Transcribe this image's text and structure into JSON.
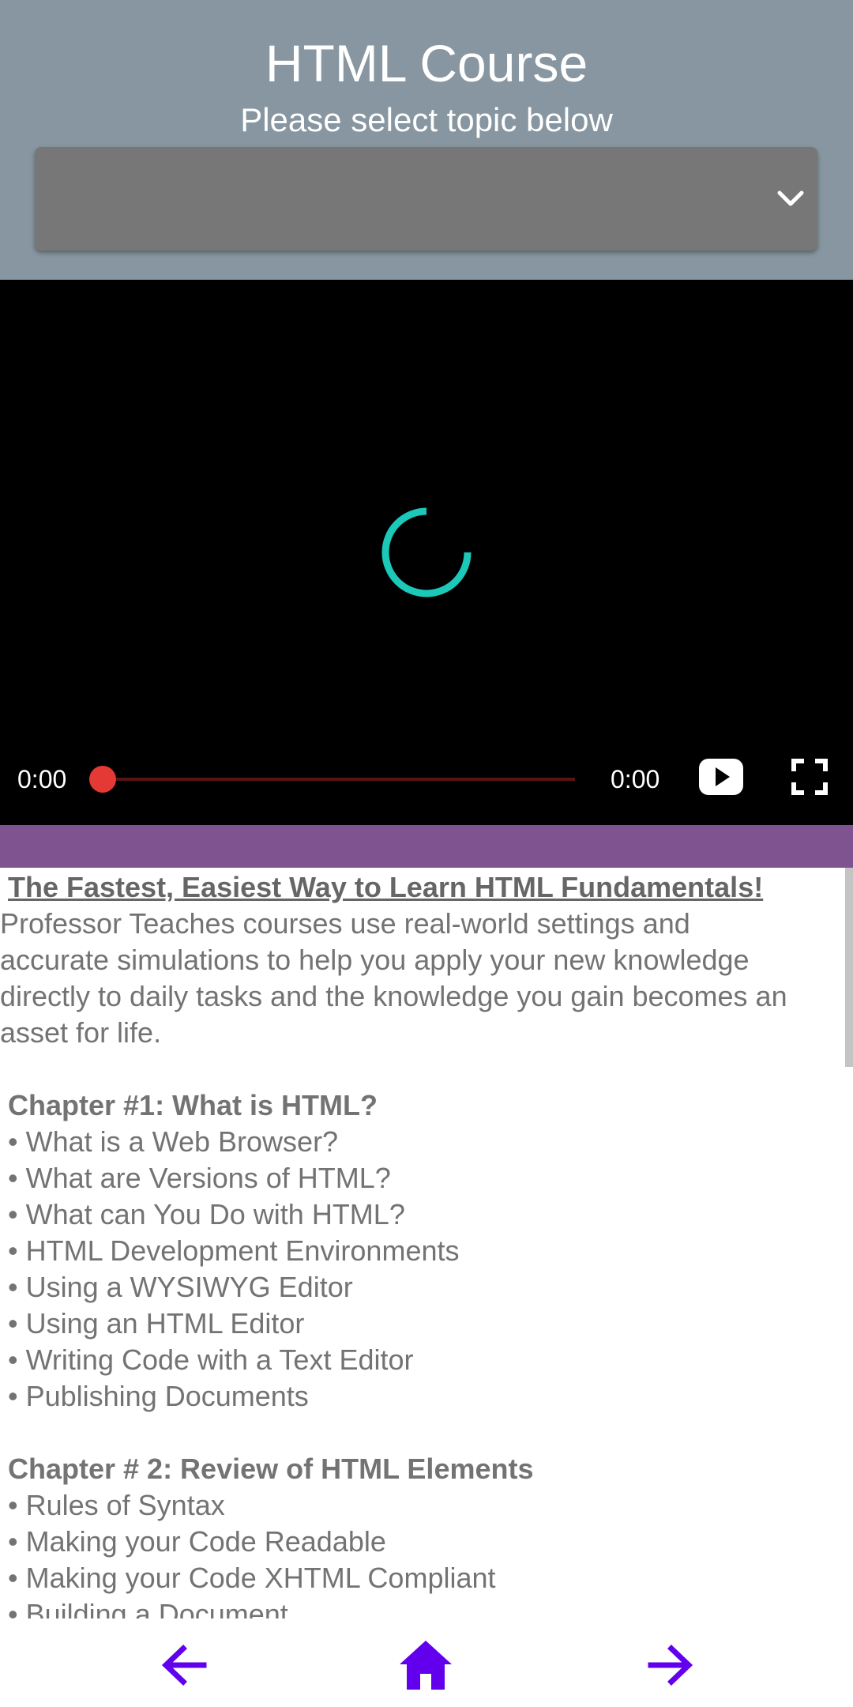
{
  "header": {
    "title": "HTML Course",
    "subtitle": "Please select topic below",
    "topic_select_value": ""
  },
  "video": {
    "current_time": "0:00",
    "duration": "0:00",
    "progress": 0,
    "state": "loading",
    "colors": {
      "spinner": "#1cc8b8",
      "thumb": "#e53935",
      "track": "#5a1313"
    }
  },
  "content": {
    "headline": "The Fastest, Easiest Way to Learn HTML Fundamentals!",
    "intro_lines": [
      " Professor Teaches courses use real-world settings and",
      "accurate simulations to help you apply your new knowledge",
      "directly to daily tasks and the knowledge you gain becomes an",
      "asset for life."
    ],
    "chapters": [
      {
        "title": "Chapter #1: What is HTML?",
        "items": [
          "• What is a Web Browser?",
          "• What are Versions of HTML?",
          "• What can You Do with HTML?",
          "• HTML Development Environments",
          "• Using a WYSIWYG Editor",
          "• Using an HTML Editor",
          "• Writing Code with a Text Editor",
          "• Publishing Documents"
        ]
      },
      {
        "title": "Chapter # 2: Review of HTML Elements",
        "items": [
          "• Rules of Syntax",
          "• Making your Code Readable",
          "• Making your Code XHTML Compliant",
          "• Building a Document"
        ]
      }
    ]
  },
  "nav": {
    "back_icon": "arrow-left-icon",
    "home_icon": "home-icon",
    "forward_icon": "arrow-right-icon",
    "accent_color": "#6200ee"
  },
  "theme": {
    "header_bg": "#8796a0",
    "band_color": "#7f5290",
    "text_color": "#737373"
  }
}
